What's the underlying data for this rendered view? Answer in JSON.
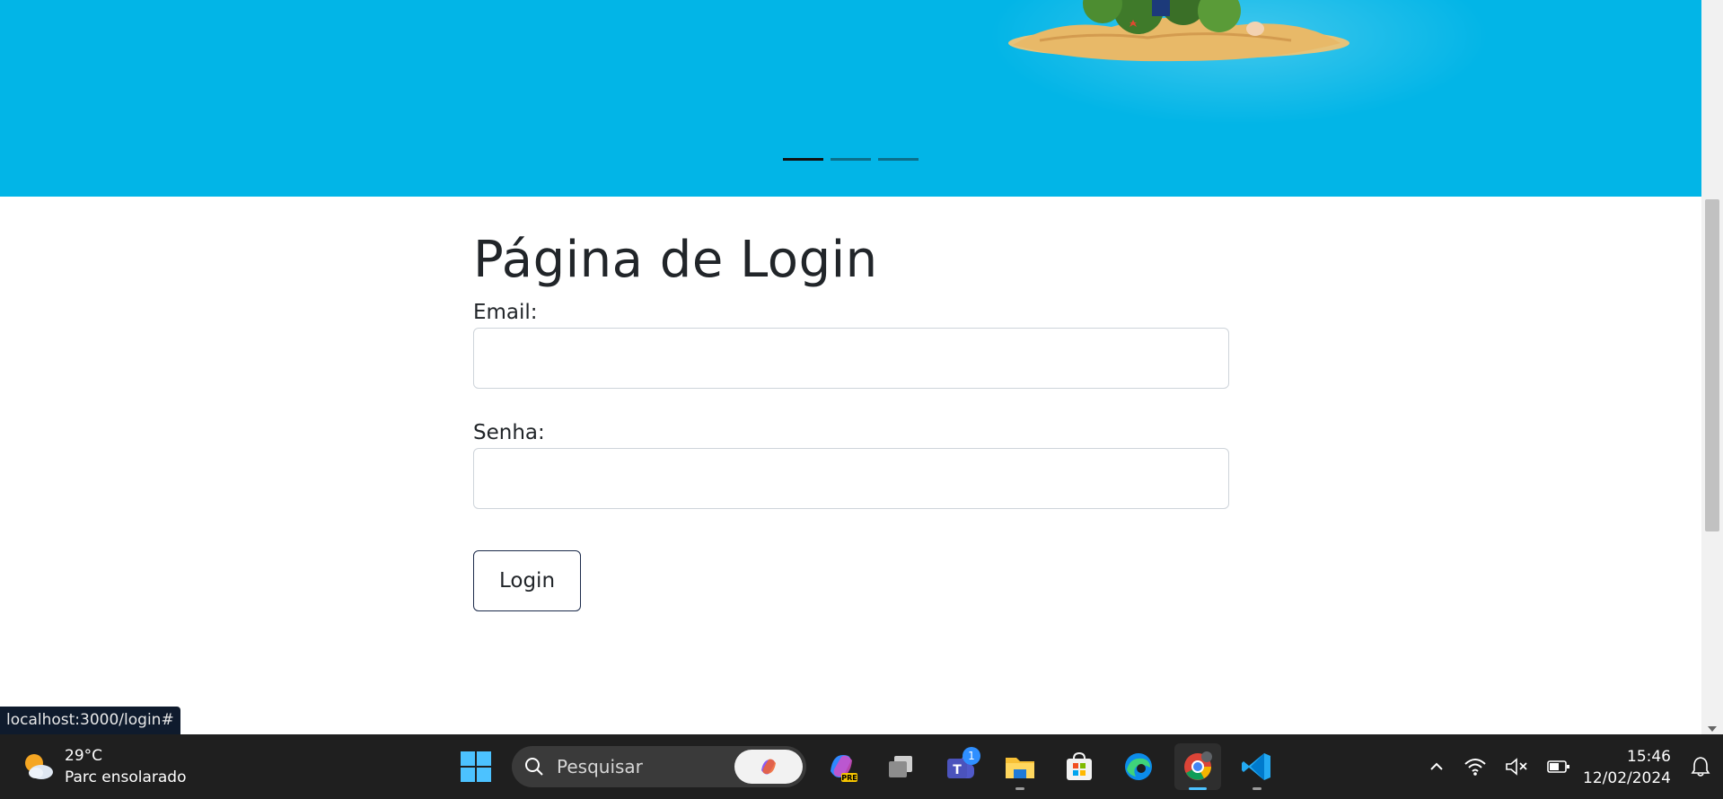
{
  "carousel": {
    "slides": 3,
    "active_index": 0
  },
  "login": {
    "title": "Página de Login",
    "email_label": "Email:",
    "email_value": "",
    "password_label": "Senha:",
    "password_value": "",
    "button_label": "Login"
  },
  "status_bar": {
    "url": "localhost:3000/login#"
  },
  "taskbar": {
    "weather": {
      "temperature": "29°C",
      "condition": "Parc ensolarado",
      "icon": "partly-sunny-icon"
    },
    "search": {
      "placeholder": "Pesquisar"
    },
    "apps": [
      {
        "name": "copilot-pre",
        "icon": "copilot-icon"
      },
      {
        "name": "task-view",
        "icon": "task-view-icon"
      },
      {
        "name": "teams",
        "icon": "teams-icon",
        "badge": "1"
      },
      {
        "name": "file-explorer",
        "icon": "folder-icon"
      },
      {
        "name": "microsoft-store",
        "icon": "store-icon"
      },
      {
        "name": "edge",
        "icon": "edge-icon"
      },
      {
        "name": "chrome",
        "icon": "chrome-icon",
        "active": true
      },
      {
        "name": "vscode",
        "icon": "vscode-icon"
      }
    ],
    "clock": {
      "time": "15:46",
      "date": "12/02/2024"
    }
  },
  "colors": {
    "hero_bg": "#02b5e7",
    "taskbar_bg": "#1f1f1f",
    "accent": "#4cc2ff"
  }
}
